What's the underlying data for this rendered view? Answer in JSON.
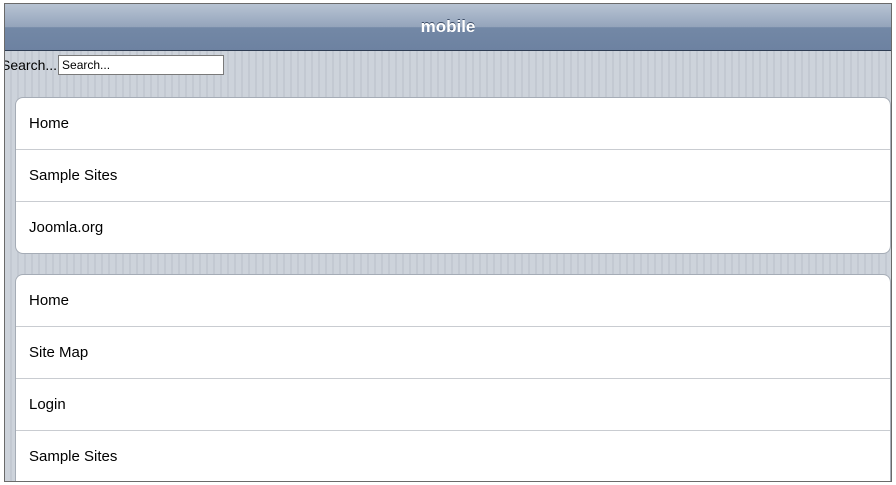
{
  "header": {
    "title": "mobile"
  },
  "search": {
    "label": "Search...",
    "value": "Search..."
  },
  "menu_top": {
    "items": [
      {
        "label": "Home"
      },
      {
        "label": "Sample Sites"
      },
      {
        "label": "Joomla.org"
      }
    ]
  },
  "menu_bottom": {
    "items": [
      {
        "label": "Home"
      },
      {
        "label": "Site Map"
      },
      {
        "label": "Login"
      },
      {
        "label": "Sample Sites"
      }
    ]
  }
}
